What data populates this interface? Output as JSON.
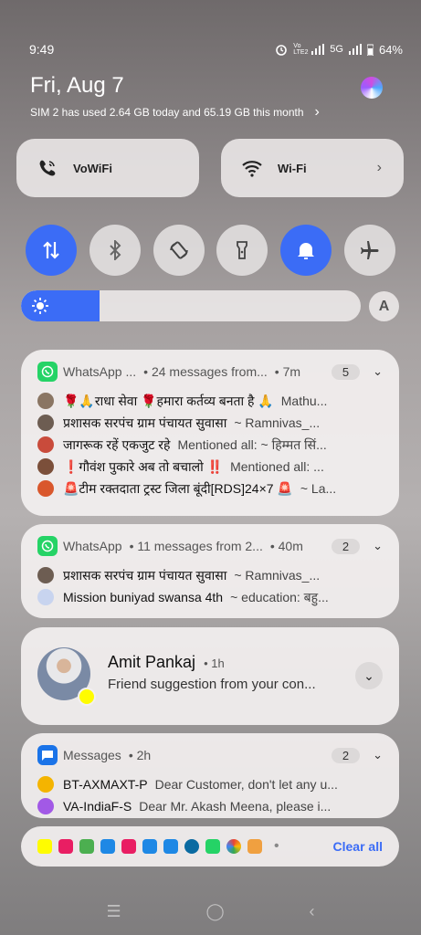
{
  "status": {
    "time": "9:49",
    "network": "5G",
    "volte": "Vo LTE2",
    "battery": "64%"
  },
  "header": {
    "date": "Fri, Aug 7",
    "usage": "SIM 2 has used 2.64 GB today and 65.19 GB this month"
  },
  "tiles": [
    {
      "label": "VoWiFi",
      "icon": "phone-wifi-icon"
    },
    {
      "label": "Wi-Fi",
      "icon": "wifi-icon"
    }
  ],
  "toggles": [
    {
      "name": "mobile-data",
      "icon": "data-arrows-icon",
      "on": true
    },
    {
      "name": "bluetooth",
      "icon": "bluetooth-icon",
      "on": false
    },
    {
      "name": "auto-rotate",
      "icon": "rotate-icon",
      "on": false
    },
    {
      "name": "flashlight",
      "icon": "flashlight-icon",
      "on": false
    },
    {
      "name": "sound",
      "icon": "bell-icon",
      "on": true
    },
    {
      "name": "airplane",
      "icon": "airplane-icon",
      "on": false
    }
  ],
  "brightness": {
    "level": 0.23,
    "auto_label": "A"
  },
  "notif1": {
    "app": "WhatsApp ...",
    "summary": "• 24 messages from...",
    "time": "• 7m",
    "count": "5",
    "rows": [
      {
        "sender": "🌹🙏राधा सेवा 🌹हमारा कर्तव्य बनता है 🙏",
        "text": "Mathu..."
      },
      {
        "sender": "प्रशासक सरपंच ग्राम पंचायत सुवासा",
        "text": "~ Ramnivas_..."
      },
      {
        "sender": "जागरूक रहें एकजुट रहे",
        "text": "Mentioned all: ~ हिम्मत सिं..."
      },
      {
        "sender": "❗गौवंश पुकारे अब तो बचालो ‼️",
        "text": "Mentioned all: ..."
      },
      {
        "sender": "🚨टीम रक्तदाता ट्रस्ट जिला बूंदी[RDS]24×7 🚨",
        "text": "~ La..."
      }
    ]
  },
  "notif2": {
    "app": "WhatsApp",
    "summary": "• 11 messages from 2...",
    "time": "• 40m",
    "count": "2",
    "rows": [
      {
        "sender": "प्रशासक सरपंच ग्राम पंचायत सुवासा",
        "text": "~ Ramnivas_..."
      },
      {
        "sender": "Mission buniyad swansa 4th",
        "text": "~ education: बहु..."
      }
    ]
  },
  "notif3": {
    "name": "Amit Pankaj",
    "time": "• 1h",
    "text": "Friend suggestion from your con..."
  },
  "notif4": {
    "app": "Messages",
    "time": "• 2h",
    "count": "2",
    "rows": [
      {
        "sender": "BT-AXMAXT-P",
        "text": "Dear Customer, don't let any u..."
      },
      {
        "sender": "VA-IndiaF-S",
        "text": "Dear Mr. Akash Meena, please i..."
      }
    ]
  },
  "footer": {
    "clear_all": "Clear all",
    "separator": "•"
  },
  "colors": {
    "accent": "#3b6cf6",
    "whatsapp": "#25d366"
  }
}
